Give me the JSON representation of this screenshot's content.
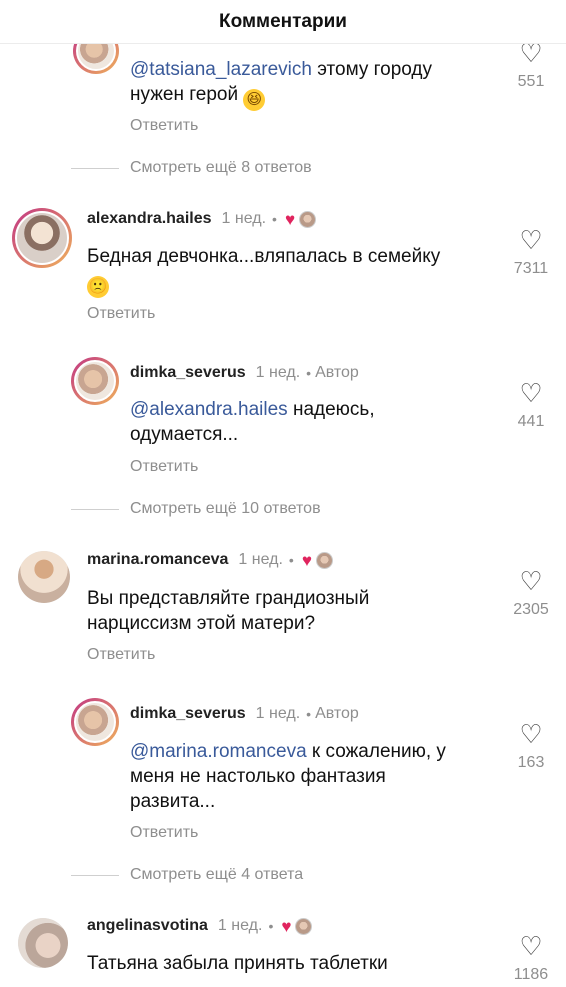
{
  "header": {
    "title": "Комментарии"
  },
  "comments": [
    {
      "id": "c0",
      "mention": "@tatsiana_lazarevich",
      "text": "этому городу",
      "text2": "нужен герой",
      "emoji": "😆",
      "reply": "Ответить",
      "likes": "551",
      "more": "Смотреть ещё 8 ответов"
    },
    {
      "id": "c1",
      "username": "alexandra.hailes",
      "time": "1 нед.",
      "dot": "•",
      "text": "Бедная девчонка...вляпалась в семейку",
      "emoji": "🙁",
      "reply": "Ответить",
      "likes": "7311"
    },
    {
      "id": "c1r",
      "username": "dimka_severus",
      "time": "1 нед.",
      "dot": "•",
      "author": "Автор",
      "mention": "@alexandra.hailes",
      "text": "надеюсь,",
      "text2": "одумается...",
      "reply": "Ответить",
      "likes": "441",
      "more": "Смотреть ещё 10 ответов"
    },
    {
      "id": "c2",
      "username": "marina.romanceva",
      "time": "1 нед.",
      "dot": "•",
      "text": "Вы представляйте грандиозный",
      "text2": "нарциссизм этой матери?",
      "reply": "Ответить",
      "likes": "2305"
    },
    {
      "id": "c2r",
      "username": "dimka_severus",
      "time": "1 нед.",
      "dot": "•",
      "author": "Автор",
      "mention": "@marina.romanceva",
      "text": "к сожалению, у",
      "text2": "меня не настолько фантазия",
      "text3": "развита...",
      "reply": "Ответить",
      "likes": "163",
      "more": "Смотреть ещё 4 ответа"
    },
    {
      "id": "c3",
      "username": "angelinasvotina",
      "time": "1 нед.",
      "dot": "•",
      "text": "Татьяна забыла принять таблетки",
      "likes": "1186"
    }
  ],
  "icons": {
    "heart_filled": "heart-filled-icon",
    "heart_outline": "heart-outline-icon"
  },
  "colors": {
    "accent_mention": "#3a5a9a",
    "like_red": "#e0245e",
    "muted": "#8e8e8e"
  }
}
